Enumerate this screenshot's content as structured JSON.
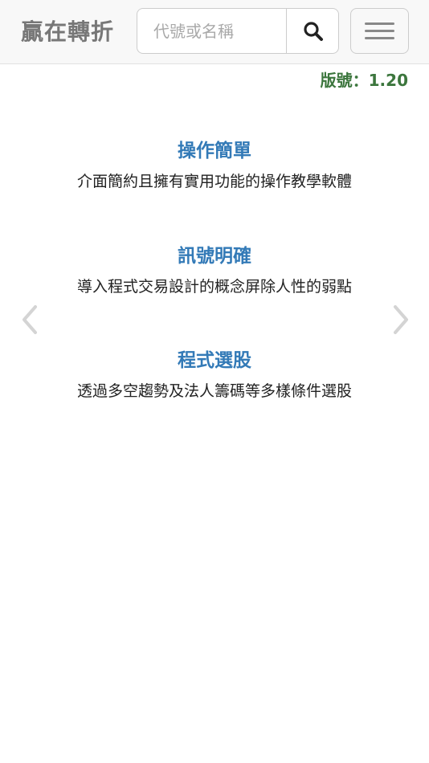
{
  "navbar": {
    "brand": "贏在轉折",
    "search": {
      "placeholder": "代號或名稱",
      "value": ""
    },
    "search_icon": "search-icon",
    "menu_icon": "hamburger-menu-icon"
  },
  "version": "版號：1.20",
  "carousel": {
    "prev_icon": "chevron-left-icon",
    "next_icon": "chevron-right-icon",
    "features": [
      {
        "title": "操作簡單",
        "description": "介面簡約且擁有實用功能的操作教學軟體"
      },
      {
        "title": "訊號明確",
        "description": "導入程式交易設計的概念屏除人性的弱點"
      },
      {
        "title": "程式選股",
        "description": "透過多空趨勢及法人籌碼等多樣條件選股"
      }
    ]
  },
  "colors": {
    "brand_text": "#777777",
    "feature_title": "#337ab7",
    "version_text": "#3c763d",
    "navbar_bg": "#f8f8f8"
  }
}
